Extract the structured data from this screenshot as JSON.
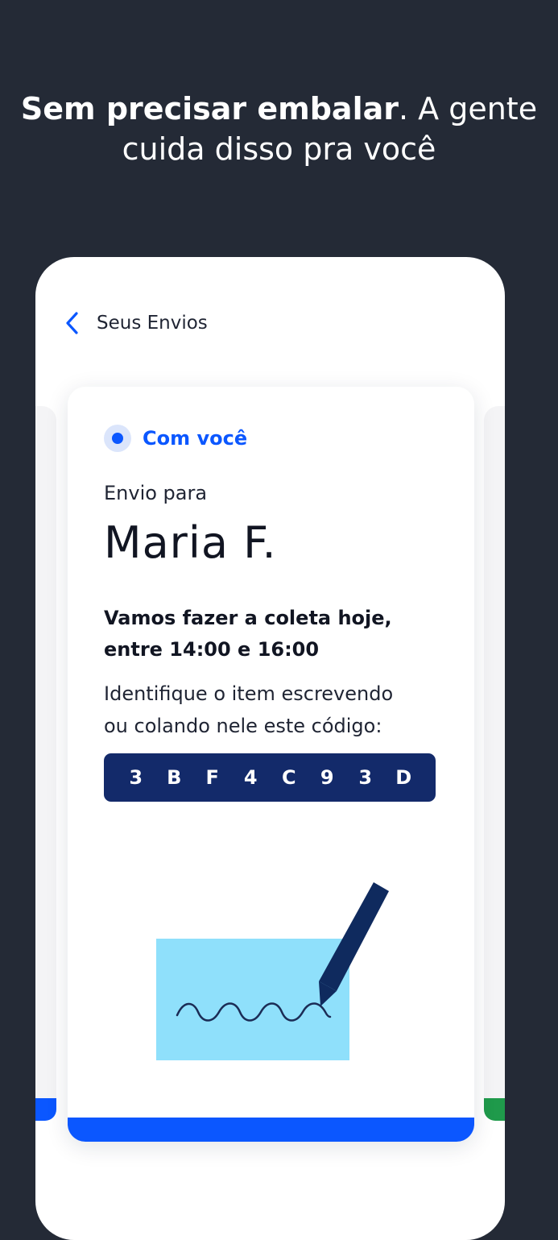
{
  "headline": {
    "bold": "Sem precisar embalar",
    "rest": ". A gente cuida disso pra você"
  },
  "nav": {
    "back_icon": "chevron-left-icon",
    "title": "Seus Envios"
  },
  "shipment": {
    "status": "Com você",
    "envio_label": "Envio para",
    "recipient": "Maria F.",
    "pickup_line1": "Vamos fazer a coleta hoje,",
    "pickup_line2": "entre 14:00 e 16:00",
    "instruction_line1": "Identifique o item escrevendo",
    "instruction_line2": "ou colando nele este código:",
    "code": [
      "3",
      "B",
      "F",
      "4",
      "C",
      "9",
      "3",
      "D"
    ]
  },
  "colors": {
    "background": "#242a36",
    "accent": "#0b57ff",
    "code_bg": "#132a6a",
    "secondary_peek": "#1f9a4b",
    "paper": "#8fe0fb",
    "pen": "#0f2a5e"
  },
  "illustration": {
    "icon": "pen-writing-on-paper-icon"
  }
}
